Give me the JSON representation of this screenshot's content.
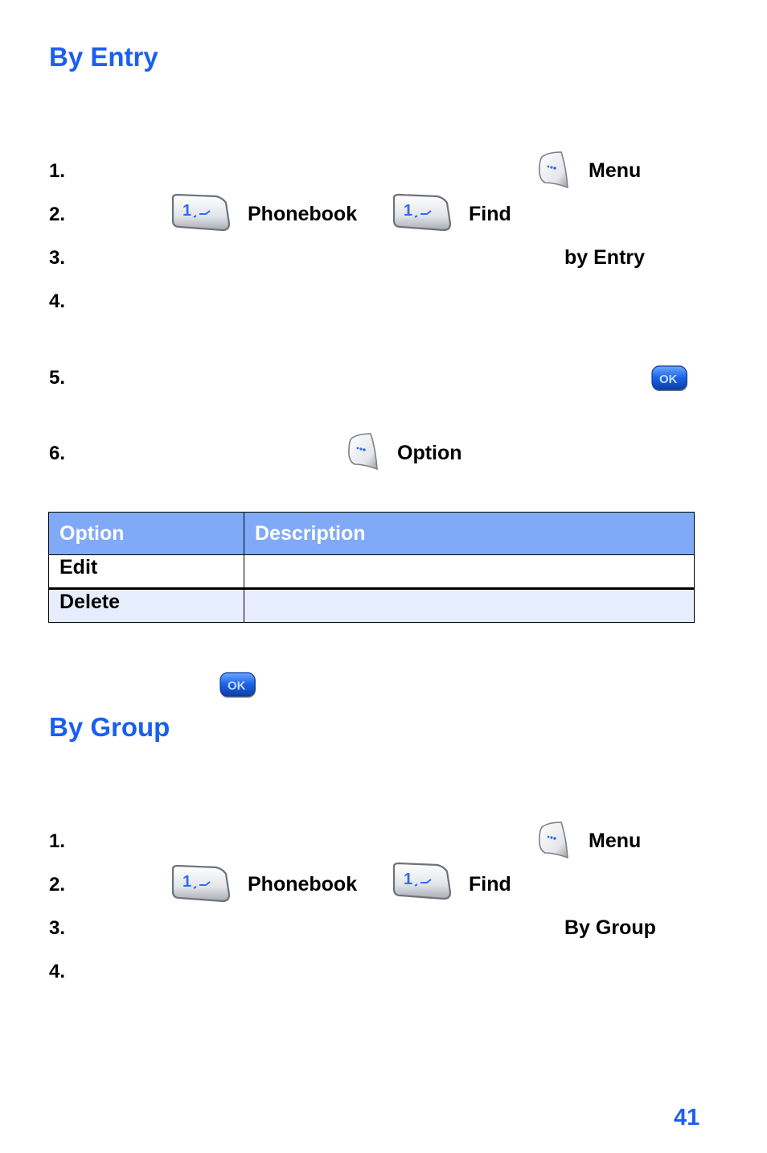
{
  "sections": [
    {
      "title": "By Entry",
      "steps": [
        {
          "num": "1.",
          "keys": [
            "Menu"
          ]
        },
        {
          "num": "2.",
          "keys": [
            "Phonebook",
            "Find"
          ]
        },
        {
          "num": "3.",
          "keys": [
            "by Entry"
          ]
        },
        {
          "num": "4.",
          "keys": []
        },
        {
          "num": "5.",
          "keys": []
        },
        {
          "num": "6.",
          "keys": [
            "Option"
          ]
        }
      ]
    },
    {
      "title": "By Group",
      "steps": [
        {
          "num": "1.",
          "keys": [
            "Menu"
          ]
        },
        {
          "num": "2.",
          "keys": [
            "Phonebook",
            "Find"
          ]
        },
        {
          "num": "3.",
          "keys": [
            "By Group"
          ]
        },
        {
          "num": "4.",
          "keys": []
        }
      ]
    }
  ],
  "options_table": {
    "headers": [
      "Option",
      "Description"
    ],
    "rows": [
      {
        "option": "Edit",
        "description": ""
      },
      {
        "option": "Delete",
        "description": ""
      }
    ]
  },
  "icons": {
    "softkey": "left-soft-key-icon",
    "numkey": "number-1-key-icon",
    "ok": "ok-key-icon",
    "ok_label": "OK",
    "numkey_label": "1"
  },
  "colors": {
    "heading": "#1a5ff0",
    "table_header_bg": "#80aaf7",
    "table_alt_row_bg": "#e6edfd"
  },
  "page_number": "41"
}
